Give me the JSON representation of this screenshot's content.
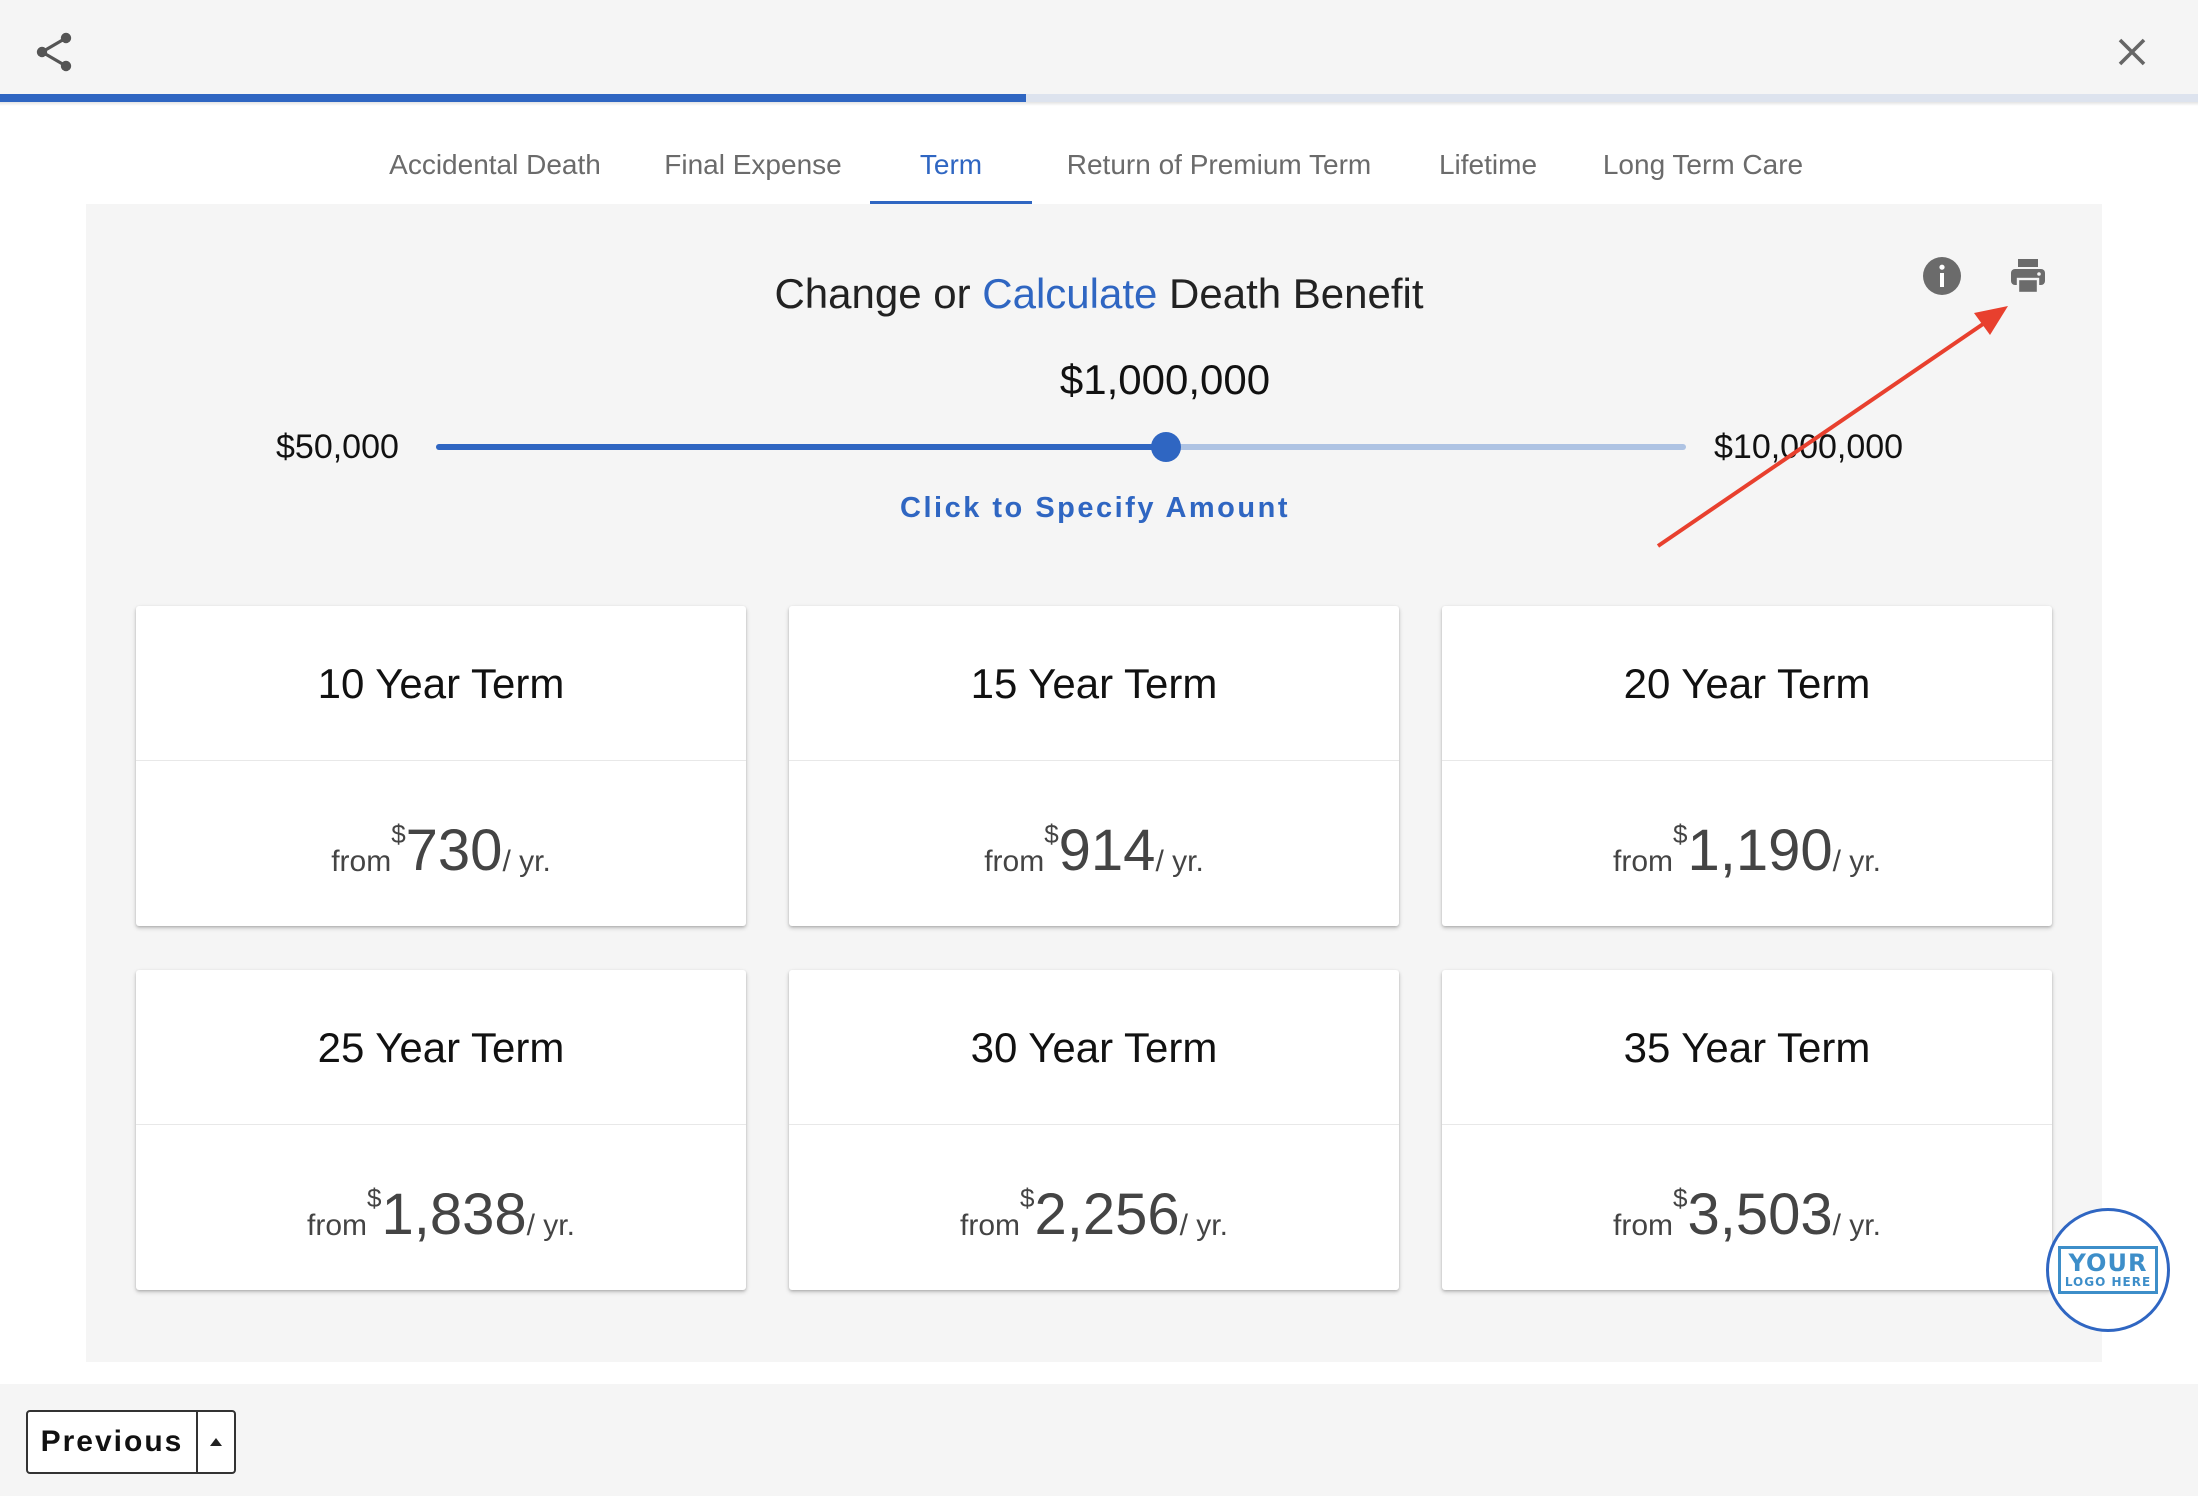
{
  "header": {
    "share_icon": "share-icon",
    "close_icon": "close-icon",
    "progress_fraction": 0.467
  },
  "tabs": [
    {
      "label": "Accidental Death",
      "active": false
    },
    {
      "label": "Final Expense",
      "active": false
    },
    {
      "label": "Term",
      "active": true
    },
    {
      "label": "Return of Premium Term",
      "active": false
    },
    {
      "label": "Lifetime",
      "active": false
    },
    {
      "label": "Long Term Care",
      "active": false
    }
  ],
  "calculator": {
    "heading_prefix": "Change or",
    "heading_link": "Calculate",
    "heading_suffix": "Death Benefit",
    "amount": "$1,000,000",
    "min_label": "$50,000",
    "max_label": "$10,000,000",
    "slider_fraction": 0.584,
    "specify_link": "Click to Specify Amount",
    "info_icon": "info-icon",
    "print_icon": "print-icon"
  },
  "cards": [
    {
      "title": "10 Year Term",
      "from": "from",
      "currency": "$",
      "price": "730",
      "per": "/ yr."
    },
    {
      "title": "15 Year Term",
      "from": "from",
      "currency": "$",
      "price": "914",
      "per": "/ yr."
    },
    {
      "title": "20 Year Term",
      "from": "from",
      "currency": "$",
      "price": "1,190",
      "per": "/ yr."
    },
    {
      "title": "25 Year Term",
      "from": "from",
      "currency": "$",
      "price": "1,838",
      "per": "/ yr."
    },
    {
      "title": "30 Year Term",
      "from": "from",
      "currency": "$",
      "price": "2,256",
      "per": "/ yr."
    },
    {
      "title": "35 Year Term",
      "from": "from",
      "currency": "$",
      "price": "3,503",
      "per": "/ yr."
    }
  ],
  "logo": {
    "line1": "YOUR",
    "line2": "LOGO HERE"
  },
  "footer": {
    "previous_label": "Previous",
    "caret_icon": "caret-up-icon"
  },
  "colors": {
    "accent": "#2f66c2",
    "annotation": "#e8402e",
    "panel_bg": "#f5f5f5"
  }
}
